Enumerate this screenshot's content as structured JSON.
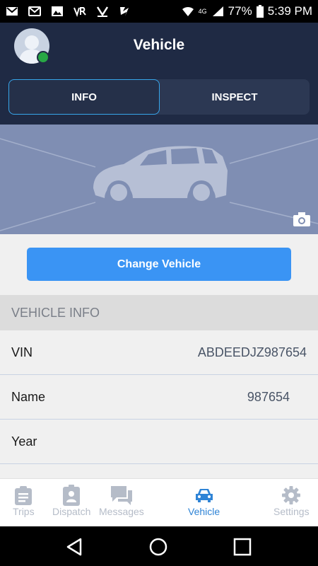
{
  "status_bar": {
    "network": "4G",
    "battery": "77%",
    "time": "5:39 PM"
  },
  "header": {
    "title": "Vehicle",
    "tabs": [
      {
        "label": "INFO",
        "active": true
      },
      {
        "label": "INSPECT",
        "active": false
      }
    ]
  },
  "actions": {
    "change_vehicle": "Change Vehicle"
  },
  "vehicle_info": {
    "section_title": "VEHICLE INFO",
    "rows": [
      {
        "label": "VIN",
        "value": "ABDEEDJZ987654"
      },
      {
        "label": "Name",
        "value": "987654"
      },
      {
        "label": "Year",
        "value": ""
      }
    ]
  },
  "bottom_nav": {
    "items": [
      {
        "label": "Trips",
        "icon": "clipboard-icon",
        "active": false
      },
      {
        "label": "Dispatch",
        "icon": "badge-icon",
        "active": false
      },
      {
        "label": "Messages",
        "icon": "chat-icon",
        "active": false
      },
      {
        "label": "Vehicle",
        "icon": "car-icon",
        "active": true
      },
      {
        "label": "Settings",
        "icon": "gear-icon",
        "active": false
      }
    ]
  },
  "colors": {
    "header_bg": "#1f2a44",
    "accent": "#3a94f4",
    "active_nav": "#2f84d6",
    "online": "#28a745"
  }
}
